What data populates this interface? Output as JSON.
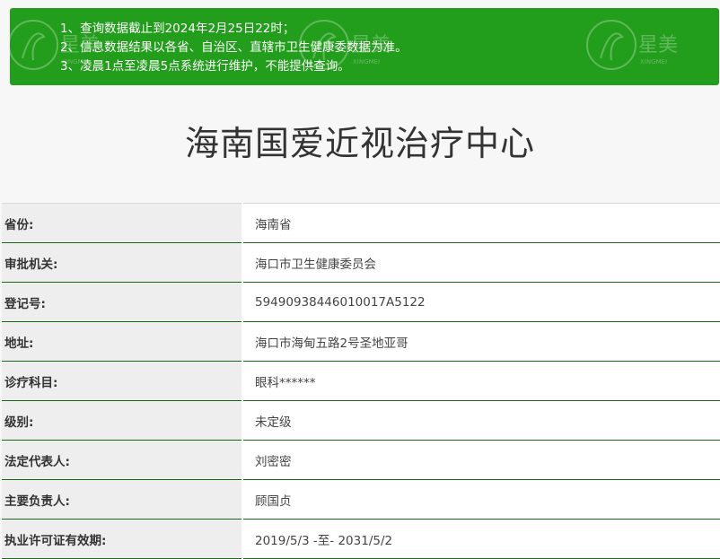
{
  "notice": {
    "lines": [
      "1、查询数据截止到2024年2月25日22时；",
      "2、信息数据结果以各省、自治区、直辖市卫生健康委数据为准。",
      "3、凌晨1点至凌晨5点系统进行维护，不能提供查询。"
    ],
    "background_color": "#239d1c"
  },
  "page": {
    "title": "海南国爱近视治疗中心"
  },
  "details": [
    {
      "label": "省份:",
      "value": "海南省"
    },
    {
      "label": "审批机关:",
      "value": "海口市卫生健康委员会"
    },
    {
      "label": "登记号:",
      "value": "59490938446010017A5122"
    },
    {
      "label": "地址:",
      "value": "海口市海甸五路2号圣地亚哥"
    },
    {
      "label": "诊疗科目:",
      "value": "眼科******"
    },
    {
      "label": "级别:",
      "value": "未定级"
    },
    {
      "label": "法定代表人:",
      "value": "刘密密"
    },
    {
      "label": "主要负责人:",
      "value": "顾国贞"
    },
    {
      "label": "执业许可证有效期:",
      "value": "2019/5/3 -至- 2031/5/2"
    }
  ],
  "watermark": {
    "text": "星美",
    "subtext": "XINGMEI"
  }
}
